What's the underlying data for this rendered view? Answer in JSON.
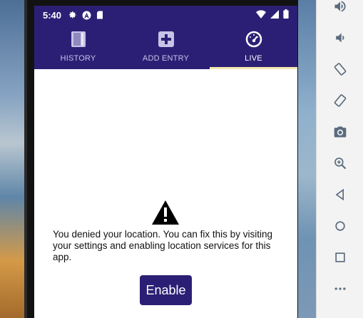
{
  "status_bar": {
    "time": "5:40",
    "icons": [
      "gear-icon",
      "a-badge-icon",
      "sd-card-icon"
    ],
    "right_icons": [
      "wifi-icon",
      "cellular-icon",
      "battery-icon"
    ]
  },
  "tabs": [
    {
      "label": "HISTORY",
      "icon": "book-icon",
      "active": false
    },
    {
      "label": "ADD ENTRY",
      "icon": "plus-box-icon",
      "active": false
    },
    {
      "label": "LIVE",
      "icon": "speedometer-icon",
      "active": true
    }
  ],
  "main": {
    "warning_icon": "warning-icon",
    "message": "You denied your location. You can fix this by visiting your settings and enabling location services for this app.",
    "enable_label": "Enable"
  },
  "emulator_toolbar": {
    "tools": [
      "volume-up-icon",
      "volume-down-icon",
      "rotate-left-icon",
      "rotate-right-icon",
      "camera-icon",
      "zoom-icon",
      "back-icon",
      "home-icon",
      "overview-icon",
      "more-icon"
    ]
  },
  "colors": {
    "primary": "#2b1f75",
    "tab_indicator": "#f4e7b0",
    "toolbar_icon": "#5a6b7e"
  }
}
